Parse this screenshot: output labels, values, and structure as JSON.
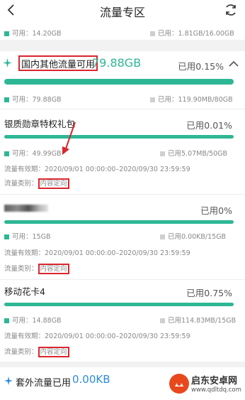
{
  "header": {
    "title": "流量专区"
  },
  "top": {
    "available": "可用：14.20GB",
    "used": "已用：1.81GB/16.00GB"
  },
  "domestic": {
    "title": "国内其他流量可用",
    "amount": "79.88GB",
    "percent": "已用0.15%",
    "available": "可用：79.88GB",
    "used": "已用：119.90MB/80GB",
    "progress_used": 0.0015
  },
  "packages": [
    {
      "name": "银质勋章特权礼包",
      "percent": "已用0.01%",
      "available": "可用：49.99GB",
      "used": "已用5.07MB/50GB",
      "validity": "流量有效期：2020/09/01 00:00:00–2020/09/30 23:59:59",
      "category_label": "流量类别：",
      "category": "内容定向",
      "progress_used": 0.0001
    },
    {
      "name": "",
      "percent": "已用0%",
      "available": "可用：15GB",
      "used": "已用0.00KB/15GB",
      "validity": "流量有效期：2020/09/01 00:00:00–2020/09/30 23:59:59",
      "category_label": "流量类别：",
      "category": "内容定向",
      "progress_used": 0
    },
    {
      "name": "移动花卡4",
      "percent": "已用0.75%",
      "available": "可用：14.88GB",
      "used": "已用114.83MB/15GB",
      "validity": "流量有效期：2020/09/01 00:00:00–2020/09/30 23:59:59",
      "category_label": "流量类别：",
      "category": "内容定向",
      "progress_used": 0.0075
    }
  ],
  "footer": {
    "label": "套外流量已用",
    "amount": "0.00KB"
  },
  "watermark": {
    "brand": "启东安卓网",
    "url": "www.qdltdq.com"
  },
  "colors": {
    "accent": "#2eb795",
    "annotation": "#d9262e",
    "blue": "#2b8de0"
  }
}
